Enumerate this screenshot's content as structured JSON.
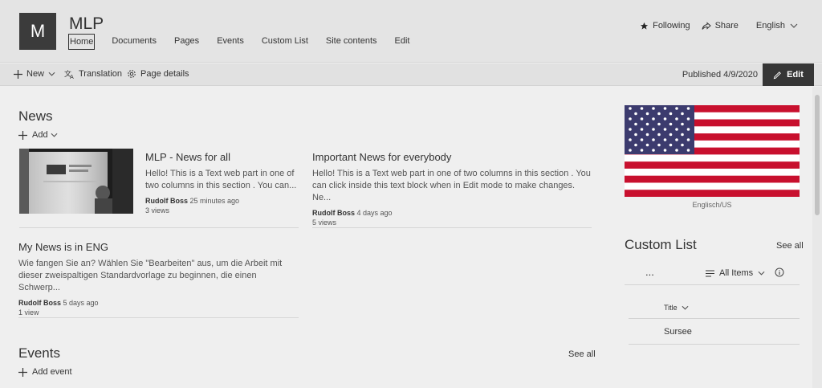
{
  "site": {
    "logo_letter": "M",
    "title": "MLP",
    "nav": [
      "Home",
      "Documents",
      "Pages",
      "Events",
      "Custom List",
      "Site contents",
      "Edit"
    ],
    "following": "Following",
    "share": "Share",
    "language": "English"
  },
  "command_bar": {
    "new_label": "New",
    "translation_label": "Translation",
    "page_details_label": "Page details",
    "published": "Published 4/9/2020",
    "edit_label": "Edit"
  },
  "news": {
    "title": "News",
    "add_label": "Add",
    "items": [
      {
        "title": "MLP - News for all",
        "desc": "Hello! This is a Text web part in one of two columns in this section . You can...",
        "author": "Rudolf Boss",
        "time": "25 minutes ago",
        "views": "3 views"
      },
      {
        "title": "Important News for everybody",
        "desc": "Hello! This is a Text web part in one of two columns in this section . You can click inside this text block when in Edit mode to make changes. Ne...",
        "author": "Rudolf Boss",
        "time": "4 days ago",
        "views": "5 views"
      },
      {
        "title": "My News is in ENG",
        "desc": "Wie fangen Sie an? Wählen Sie \"Bearbeiten\" aus, um die Arbeit mit dieser zweispaltigen Standardvorlage zu beginnen, die einen Schwerp...",
        "author": "Rudolf Boss",
        "time": "5 days ago",
        "views": "1 view"
      }
    ]
  },
  "events": {
    "title": "Events",
    "see_all": "See all",
    "add_label": "Add event"
  },
  "flag": {
    "caption": "Englisch/US",
    "colors": {
      "red": "#c8102e",
      "white": "#ffffff",
      "blue": "#3c3b6e"
    }
  },
  "custom_list": {
    "title": "Custom List",
    "see_all": "See all",
    "more": "...",
    "view_label": "All Items",
    "column_title": "Title",
    "rows": [
      "Sursee"
    ]
  },
  "colors": {
    "header_bg": "#e4e4e4",
    "page_bg": "#efefef",
    "edit_btn_bg": "#363636"
  }
}
